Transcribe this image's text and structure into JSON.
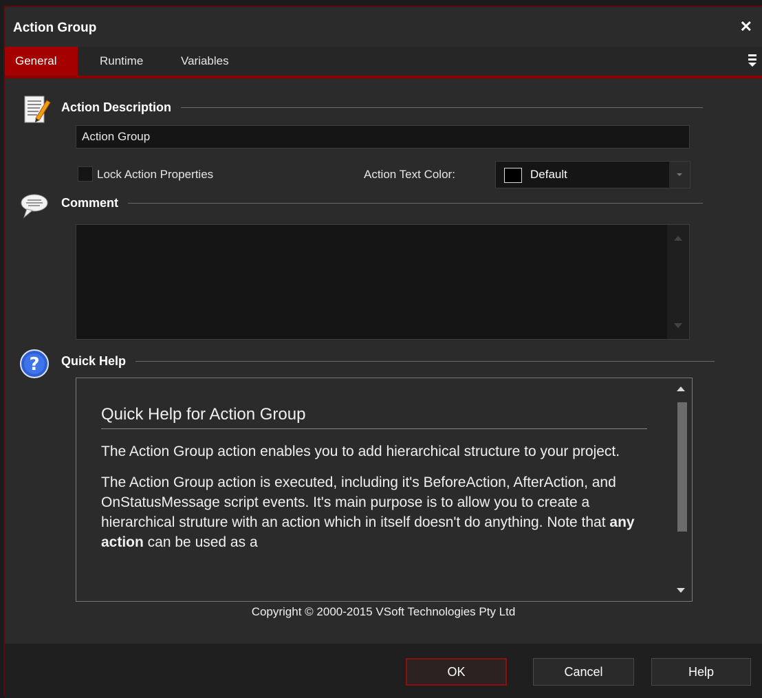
{
  "window": {
    "title": "Action Group"
  },
  "tabs": [
    {
      "label": "General",
      "active": true
    },
    {
      "label": "Runtime",
      "active": false
    },
    {
      "label": "Variables",
      "active": false
    }
  ],
  "description": {
    "heading": "Action Description",
    "value": "Action Group",
    "lock_label": "Lock Action Properties",
    "lock_checked": false,
    "text_color_label": "Action Text Color:",
    "text_color_value": "Default",
    "text_color_swatch": "#000000"
  },
  "comment": {
    "heading": "Comment",
    "value": ""
  },
  "help": {
    "heading": "Quick Help",
    "title": "Quick Help for Action Group",
    "paragraph1": "The Action Group action enables you to add hierarchical structure to your project.",
    "paragraph2_part1": "The Action Group action is executed, including it's BeforeAction, AfterAction, and OnStatusMessage script events. It's main purpose is to allow you to create a hierarchical struture with an action which in itself doesn't do anything. Note that ",
    "paragraph2_bold": "any action",
    "paragraph2_part2": " can be used as a"
  },
  "copyright": "Copyright © 2000-2015 VSoft Technologies Pty Ltd",
  "buttons": {
    "ok": "OK",
    "cancel": "Cancel",
    "help": "Help"
  },
  "colors": {
    "accent": "#a40000",
    "background": "#2b2b2b",
    "input_bg": "#151515"
  },
  "icons": {
    "description": "document-edit-icon",
    "comment": "speech-bubble-icon",
    "help": "question-mark-icon",
    "close": "close-icon",
    "menu": "tab-menu-icon"
  }
}
